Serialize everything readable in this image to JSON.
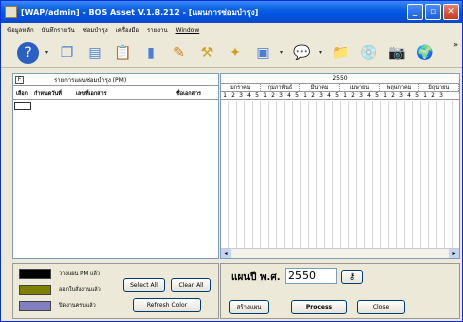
{
  "window": {
    "title": "[WAP/admin] - BOS Asset V.1.8.212 - [แผนการซ่อมบำรุง]"
  },
  "menu": [
    "ข้อมูลหลัก",
    "บันทึกรายวัน",
    "ซ่อมบำรุง",
    "เครื่องมือ",
    "รายงาน",
    "Window"
  ],
  "toolbar": [
    "help-icon",
    "copy-icon",
    "pages-icon",
    "clipboard-icon",
    "document-icon",
    "tools-icon",
    "wrench-icon",
    "wand-icon",
    "monitor-icon",
    "chat-icon",
    "folder-icon",
    "disc-icon",
    "camera-icon",
    "globe-icon"
  ],
  "left_pane": {
    "f_label": "F",
    "title": "รายการแผนซ่อมบำรุง (PM)",
    "columns": [
      "เลือก",
      "กำหนดวันที่",
      "เลขที่เอกสาร",
      "ชื่อเอกสาร"
    ]
  },
  "right_pane": {
    "year": "2550",
    "months": [
      "มกราคม",
      "กุมภาพันธ์",
      "มีนาคม",
      "เมษายน",
      "พฤษภาคม",
      "มิถุนายน"
    ],
    "weeks": [
      "1",
      "2",
      "3",
      "4",
      "5",
      "1",
      "2",
      "3",
      "4",
      "5",
      "1",
      "2",
      "3",
      "4",
      "5",
      "1",
      "2",
      "3",
      "4",
      "5",
      "1",
      "2",
      "3",
      "4",
      "5",
      "1",
      "2",
      "3"
    ]
  },
  "legend": [
    {
      "color": "#000000",
      "label": "วางแผน PM แล้ว"
    },
    {
      "color": "#808000",
      "label": "ออกใบสั่งงานแล้ว"
    },
    {
      "color": "#8080c0",
      "label": "ปิดงานครบแล้ว"
    }
  ],
  "buttons": {
    "select_all": "Select All",
    "clear_all": "Clear All",
    "refresh_color": "Refresh Color",
    "create_plan": "สร้างแผน",
    "process": "Process",
    "close": "Close"
  },
  "plan": {
    "label": "แผนปี พ.ศ.",
    "year_value": "2550"
  }
}
